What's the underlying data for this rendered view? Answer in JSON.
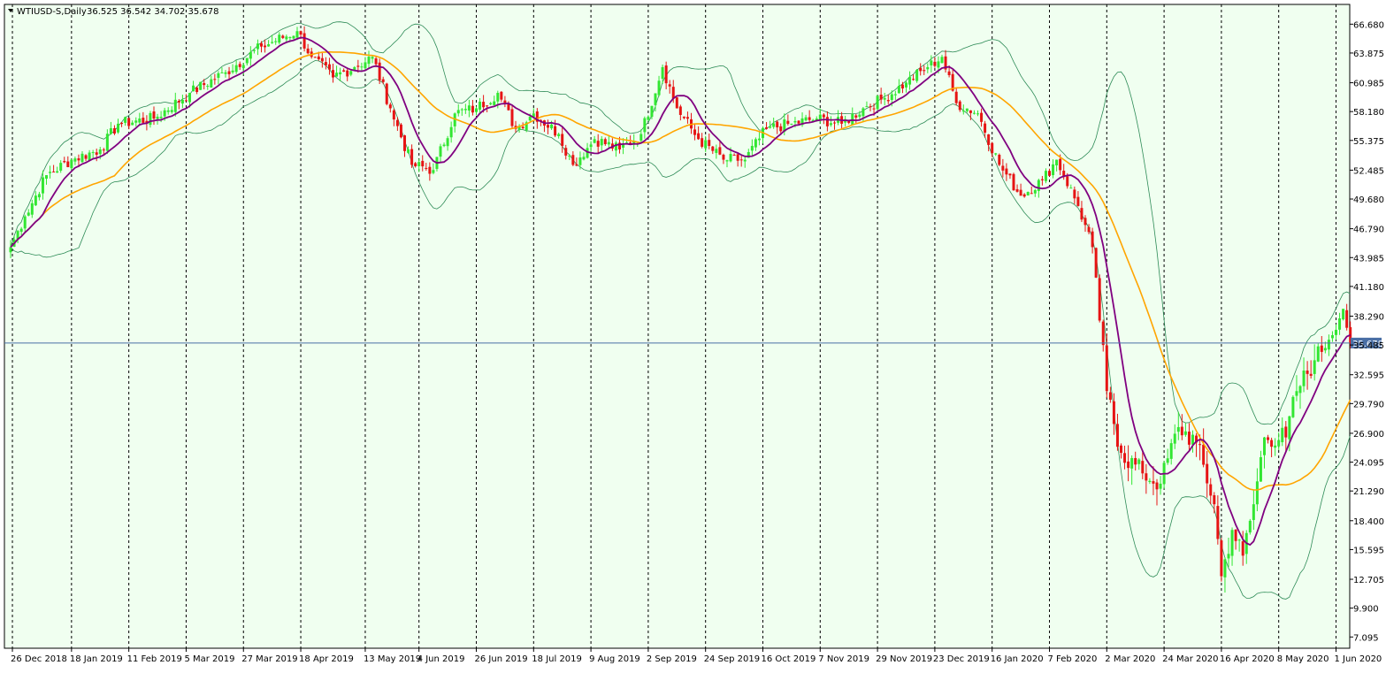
{
  "header": {
    "symbol_label": "WTIUSD-S,Daily",
    "ohlc_label": "36.525 36.542 34.702 35.678",
    "dropdown_icon": "triangle-down-icon"
  },
  "colors": {
    "background": "#F0FFF0",
    "grid": "#000000",
    "bull": "#32E632",
    "bear": "#E61414",
    "bollinger": "#2E8B57",
    "ma_fast": "#800080",
    "ma_slow": "#FFA500",
    "price_line": "#4A6FA5",
    "price_tag_bg": "#4A6FA5",
    "price_tag_text": "#FFFFFF"
  },
  "chart_data": {
    "type": "candlestick",
    "title": "WTIUSD-S,Daily",
    "last_price": 35.678,
    "ylim": [
      6.0,
      68.6
    ],
    "y_ticks": [
      "66.680",
      "63.875",
      "60.985",
      "58.180",
      "55.375",
      "52.485",
      "49.680",
      "46.790",
      "43.985",
      "41.180",
      "38.290",
      "35.485",
      "32.595",
      "29.790",
      "26.900",
      "24.095",
      "21.290",
      "18.400",
      "15.595",
      "12.705",
      "9.900",
      "7.095"
    ],
    "x_ticks": [
      "26 Dec 2018",
      "18 Jan 2019",
      "11 Feb 2019",
      "5 Mar 2019",
      "27 Mar 2019",
      "18 Apr 2019",
      "13 May 2019",
      "4 Jun 2019",
      "26 Jun 2019",
      "18 Jul 2019",
      "9 Aug 2019",
      "2 Sep 2019",
      "24 Sep 2019",
      "16 Oct 2019",
      "7 Nov 2019",
      "29 Nov 2019",
      "23 Dec 2019",
      "16 Jan 2020",
      "7 Feb 2020",
      "2 Mar 2020",
      "24 Mar 2020",
      "16 Apr 2020",
      "8 May 2020",
      "1 Jun 2020"
    ],
    "x_tick_positions": [
      0.5,
      17,
      33,
      49,
      65,
      81,
      99,
      114,
      130,
      146,
      162,
      178,
      194,
      210,
      226,
      242,
      258,
      274,
      290,
      306,
      322,
      338,
      354,
      370
    ],
    "bars_total": 375,
    "anchors": [
      {
        "i": 0,
        "c": 45.0
      },
      {
        "i": 4,
        "c": 48.0
      },
      {
        "i": 10,
        "c": 52.0
      },
      {
        "i": 17,
        "c": 53.5
      },
      {
        "i": 25,
        "c": 54.5
      },
      {
        "i": 30,
        "c": 57.0
      },
      {
        "i": 40,
        "c": 57.5
      },
      {
        "i": 50,
        "c": 60.0
      },
      {
        "i": 60,
        "c": 62.0
      },
      {
        "i": 70,
        "c": 64.5
      },
      {
        "i": 80,
        "c": 66.0
      },
      {
        "i": 84,
        "c": 63.5
      },
      {
        "i": 90,
        "c": 61.5
      },
      {
        "i": 96,
        "c": 62.5
      },
      {
        "i": 101,
        "c": 63.5
      },
      {
        "i": 106,
        "c": 58.5
      },
      {
        "i": 112,
        "c": 53.0
      },
      {
        "i": 118,
        "c": 52.5
      },
      {
        "i": 124,
        "c": 58.0
      },
      {
        "i": 130,
        "c": 58.5
      },
      {
        "i": 136,
        "c": 60.0
      },
      {
        "i": 141,
        "c": 56.5
      },
      {
        "i": 146,
        "c": 58.0
      },
      {
        "i": 153,
        "c": 56.0
      },
      {
        "i": 157,
        "c": 53.0
      },
      {
        "i": 163,
        "c": 55.5
      },
      {
        "i": 170,
        "c": 54.5
      },
      {
        "i": 176,
        "c": 56.0
      },
      {
        "i": 182,
        "c": 62.5
      },
      {
        "i": 186,
        "c": 58.5
      },
      {
        "i": 192,
        "c": 55.5
      },
      {
        "i": 199,
        "c": 53.5
      },
      {
        "i": 205,
        "c": 53.5
      },
      {
        "i": 211,
        "c": 56.5
      },
      {
        "i": 218,
        "c": 57.0
      },
      {
        "i": 225,
        "c": 57.5
      },
      {
        "i": 232,
        "c": 57.0
      },
      {
        "i": 238,
        "c": 58.5
      },
      {
        "i": 244,
        "c": 59.5
      },
      {
        "i": 250,
        "c": 61.0
      },
      {
        "i": 256,
        "c": 62.5
      },
      {
        "i": 260,
        "c": 63.5
      },
      {
        "i": 264,
        "c": 59.0
      },
      {
        "i": 270,
        "c": 58.0
      },
      {
        "i": 276,
        "c": 53.0
      },
      {
        "i": 282,
        "c": 50.0
      },
      {
        "i": 288,
        "c": 51.5
      },
      {
        "i": 292,
        "c": 53.5
      },
      {
        "i": 298,
        "c": 49.0
      },
      {
        "i": 302,
        "c": 45.0
      },
      {
        "i": 306,
        "c": 31.0
      },
      {
        "i": 310,
        "c": 25.0
      },
      {
        "i": 316,
        "c": 23.0
      },
      {
        "i": 321,
        "c": 22.0
      },
      {
        "i": 326,
        "c": 27.5
      },
      {
        "i": 331,
        "c": 26.0
      },
      {
        "i": 336,
        "c": 20.0
      },
      {
        "i": 338,
        "c": 13.0
      },
      {
        "i": 341,
        "c": 17.5
      },
      {
        "i": 344,
        "c": 15.0
      },
      {
        "i": 347,
        "c": 20.0
      },
      {
        "i": 350,
        "c": 26.5
      },
      {
        "i": 356,
        "c": 26.5
      },
      {
        "i": 359,
        "c": 31.0
      },
      {
        "i": 364,
        "c": 34.0
      },
      {
        "i": 368,
        "c": 36.0
      },
      {
        "i": 372,
        "c": 39.0
      },
      {
        "i": 374,
        "c": 35.678
      }
    ],
    "ma_fast_period": 10,
    "ma_slow_period": 30,
    "bollinger_period": 20,
    "bollinger_dev": 2,
    "grid": "vertical-dashed",
    "price_line": 35.678
  }
}
